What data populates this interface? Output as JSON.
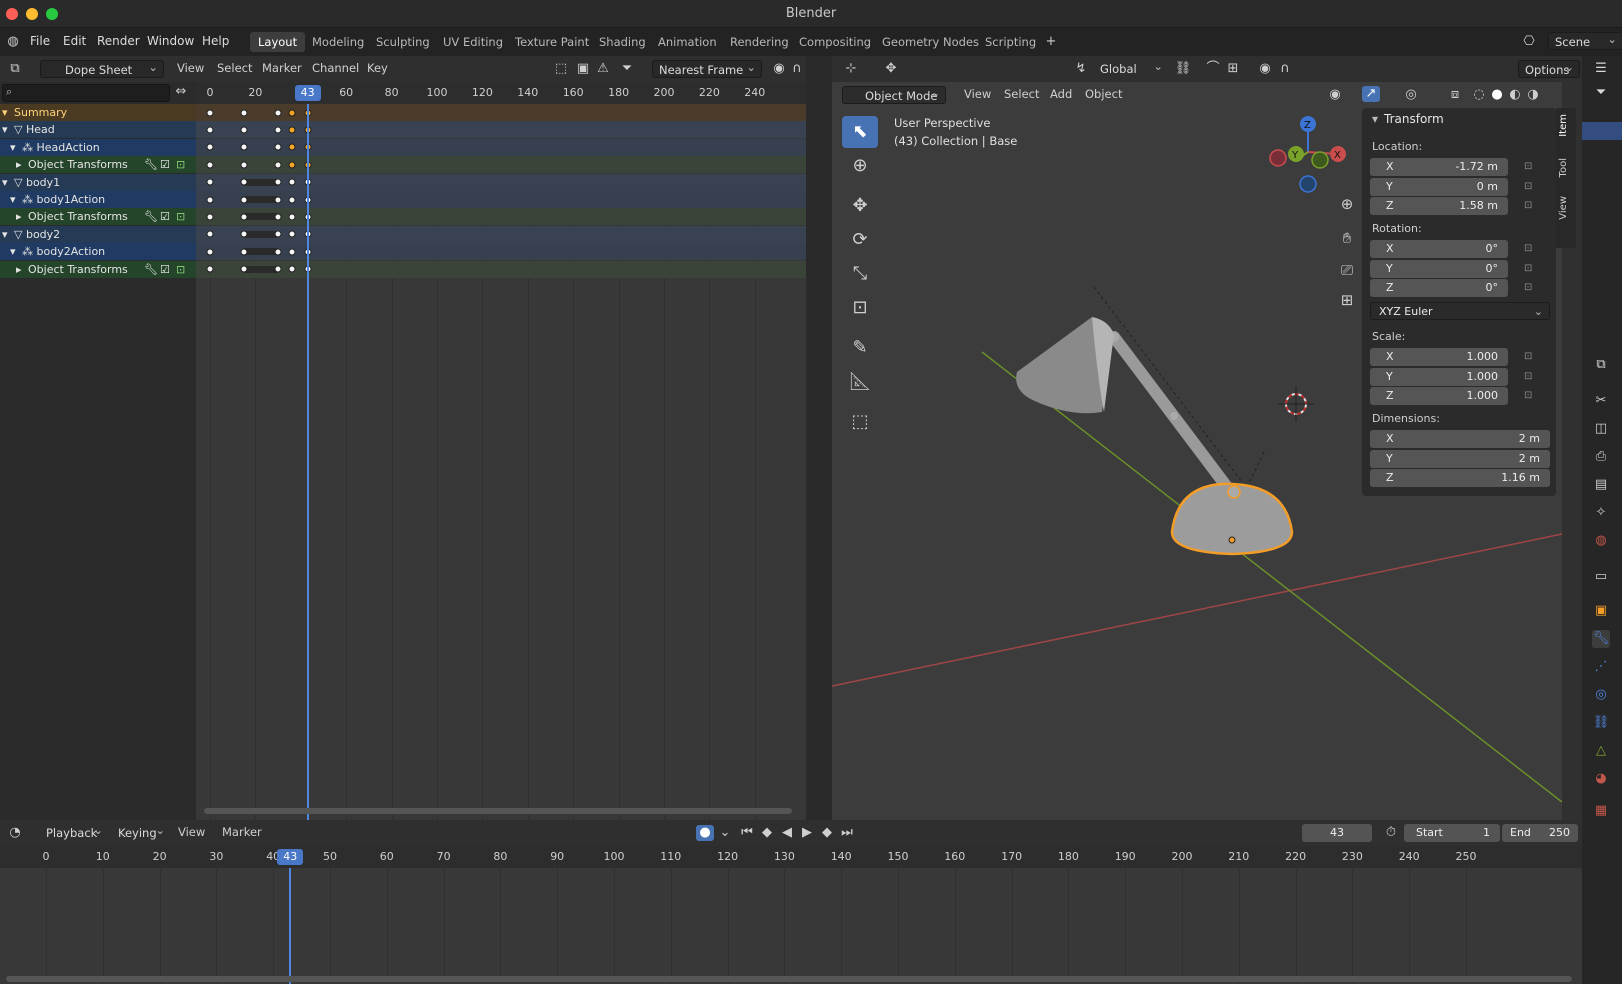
{
  "app_title": "Blender",
  "colors": {
    "accent": "#4772b3",
    "selection": "#f6a623",
    "playhead": "#4f86e0",
    "x_axis": "#c94d4d",
    "y_axis": "#7aa12a",
    "z_axis": "#3b74d6"
  },
  "menu": [
    "File",
    "Edit",
    "Render",
    "Window",
    "Help"
  ],
  "workspaces": [
    "Layout",
    "Modeling",
    "Sculpting",
    "UV Editing",
    "Texture Paint",
    "Shading",
    "Animation",
    "Rendering",
    "Compositing",
    "Geometry Nodes",
    "Scripting"
  ],
  "active_workspace": "Layout",
  "scene": "Scene",
  "dopesheet": {
    "mode": "Dope Sheet",
    "menus": [
      "View",
      "Select",
      "Marker",
      "Channel",
      "Key"
    ],
    "snap": "Nearest Frame",
    "ruler_ticks": [
      "0",
      "20",
      "60",
      "80",
      "100",
      "120",
      "140",
      "160",
      "180",
      "200",
      "220",
      "240"
    ],
    "current_frame": "43",
    "channels": [
      {
        "label": "Summary",
        "icon": "triangle-down-icon",
        "type": "summary"
      },
      {
        "label": "Head",
        "icon": "object-icon",
        "type": "object"
      },
      {
        "label": "HeadAction",
        "icon": "action-icon",
        "type": "action"
      },
      {
        "label": "Object Transforms",
        "icon": "triangle-right-icon",
        "type": "group"
      },
      {
        "label": "body1",
        "icon": "object-icon",
        "type": "object"
      },
      {
        "label": "body1Action",
        "icon": "action-icon",
        "type": "action"
      },
      {
        "label": "Object Transforms",
        "icon": "triangle-right-icon",
        "type": "group"
      },
      {
        "label": "body2",
        "icon": "object-icon",
        "type": "object"
      },
      {
        "label": "body2Action",
        "icon": "action-icon",
        "type": "action"
      },
      {
        "label": "Object Transforms",
        "icon": "triangle-right-icon",
        "type": "group"
      }
    ],
    "keyframes_frames": [
      0,
      15,
      30,
      36,
      43
    ],
    "selected_rows": [
      0,
      1,
      2,
      3
    ]
  },
  "viewport": {
    "orientation": "Global",
    "options_label": "Options",
    "mode": "Object Mode",
    "menus": [
      "View",
      "Select",
      "Add",
      "Object"
    ],
    "info_line1": "User Perspective",
    "info_line2": "(43) Collection | Base",
    "gizmo": {
      "x": "X",
      "y": "Y",
      "z": "Z"
    }
  },
  "npanel": {
    "title": "Transform",
    "tabs": [
      "Item",
      "Tool",
      "View"
    ],
    "location_label": "Location:",
    "location": [
      {
        "axis": "X",
        "value": "-1.72 m"
      },
      {
        "axis": "Y",
        "value": "0 m"
      },
      {
        "axis": "Z",
        "value": "1.58 m"
      }
    ],
    "rotation_label": "Rotation:",
    "rotation": [
      {
        "axis": "X",
        "value": "0°"
      },
      {
        "axis": "Y",
        "value": "0°"
      },
      {
        "axis": "Z",
        "value": "0°"
      }
    ],
    "rotation_mode": "XYZ Euler",
    "scale_label": "Scale:",
    "scale": [
      {
        "axis": "X",
        "value": "1.000"
      },
      {
        "axis": "Y",
        "value": "1.000"
      },
      {
        "axis": "Z",
        "value": "1.000"
      }
    ],
    "dimensions_label": "Dimensions:",
    "dimensions": [
      {
        "axis": "X",
        "value": "2 m"
      },
      {
        "axis": "Y",
        "value": "2 m"
      },
      {
        "axis": "Z",
        "value": "1.16 m"
      }
    ]
  },
  "timeline": {
    "menus": [
      "Playback",
      "Keying",
      "View",
      "Marker"
    ],
    "current_frame": "43",
    "start_label": "Start",
    "start": "1",
    "end_label": "End",
    "end": "250",
    "ruler_ticks": [
      "0",
      "10",
      "20",
      "30",
      "40",
      "50",
      "60",
      "70",
      "80",
      "90",
      "100",
      "110",
      "120",
      "130",
      "140",
      "150",
      "160",
      "170",
      "180",
      "190",
      "200",
      "210",
      "220",
      "230",
      "240",
      "250"
    ]
  }
}
